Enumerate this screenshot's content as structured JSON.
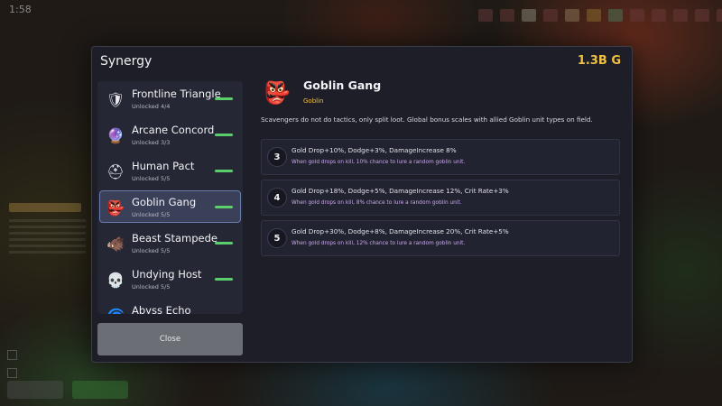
{
  "modal": {
    "title": "Synergy",
    "currency": "1.3B G",
    "close_label": "Close"
  },
  "synergies": [
    {
      "name": "Frontline Triangle",
      "status": "Unlocked 4/4",
      "icon": "crystal-shield-icon",
      "glyph": "🛡",
      "selected": false
    },
    {
      "name": "Arcane Concord",
      "status": "Unlocked 3/3",
      "icon": "arcane-crystal-icon",
      "glyph": "🔮",
      "selected": false
    },
    {
      "name": "Human Pact",
      "status": "Unlocked 5/5",
      "icon": "human-helmet-icon",
      "glyph": "⛑",
      "selected": false
    },
    {
      "name": "Goblin Gang",
      "status": "Unlocked 5/5",
      "icon": "goblin-head-icon",
      "glyph": "👺",
      "selected": true
    },
    {
      "name": "Beast Stampede",
      "status": "Unlocked 5/5",
      "icon": "beast-head-icon",
      "glyph": "🐗",
      "selected": false
    },
    {
      "name": "Undying Host",
      "status": "Unlocked 5/5",
      "icon": "undead-skull-icon",
      "glyph": "💀",
      "selected": false
    },
    {
      "name": "Abyss Echo",
      "status": "",
      "icon": "abyss-icon",
      "glyph": "🌀",
      "selected": false
    }
  ],
  "detail": {
    "name": "Goblin Gang",
    "tag": "Goblin",
    "icon": "goblin-head-icon",
    "glyph": "👺",
    "description": "Scavengers do not do tactics, only split loot. Global bonus scales with allied Goblin unit types on field.",
    "tiers": [
      {
        "count": "3",
        "stats": "Gold Drop+10%, Dodge+3%, DamageIncrease 8%",
        "note": "When gold drops on kill, 10% chance to lure a random goblin unit."
      },
      {
        "count": "4",
        "stats": "Gold Drop+18%, Dodge+5%, DamageIncrease 12%, Crit Rate+3%",
        "note": "When gold drops on kill, 8% chance to lure a random goblin unit."
      },
      {
        "count": "5",
        "stats": "Gold Drop+30%, Dodge+8%, DamageIncrease 20%, Crit Rate+5%",
        "note": "When gold drops on kill, 12% chance to lure a random goblin unit."
      }
    ]
  },
  "colors": {
    "accent_gold": "#f0c040",
    "progress_green": "#5bd06a",
    "selected_border": "#6b7db0",
    "tier_note": "#c9a8ec"
  },
  "hud": {
    "time": "1:58"
  }
}
